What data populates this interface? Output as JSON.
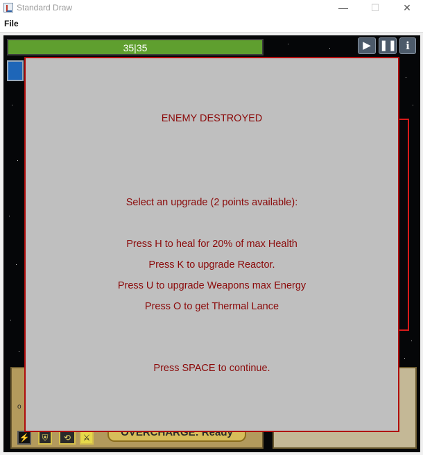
{
  "window": {
    "title": "Standard Draw",
    "minimize": "—",
    "maximize": "☐",
    "close": "✕"
  },
  "menu": {
    "file": "File"
  },
  "hud": {
    "health": "35|35",
    "play_icon": "play-icon",
    "pause_icon": "pause-icon",
    "info_icon": "info-icon",
    "overcharge": "OVERCHARGE: Ready",
    "abilities": [
      "lightning-icon",
      "shield-icon",
      "cycle-icon",
      "lance-icon"
    ]
  },
  "colors": {
    "health_bar": "#5f9f2f",
    "dialog_bg": "#bfbfbf",
    "dialog_text": "#8b0a0a",
    "dialog_border": "#b00d0d",
    "enemy_border": "#d81a1a"
  },
  "dialog": {
    "heading": "ENEMY DESTROYED",
    "prompt": "Select an upgrade (2 points available):",
    "options": [
      "Press H to heal for 20% of max Health",
      "Press K to upgrade Reactor.",
      "Press U to upgrade Weapons max Energy",
      "Press O to get Thermal Lance"
    ],
    "continue": "Press SPACE to continue."
  }
}
